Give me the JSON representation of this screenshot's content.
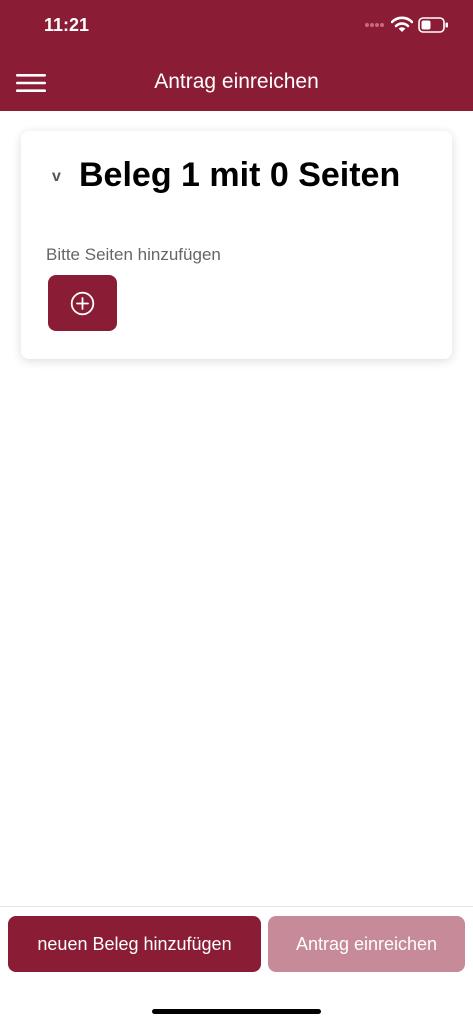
{
  "status_bar": {
    "time": "11:21"
  },
  "header": {
    "title": "Antrag einreichen",
    "menu_icon": "hamburger-menu-icon"
  },
  "card": {
    "collapse_glyph": "v",
    "title": "Beleg 1 mit 0 Seiten",
    "hint": "Bitte Seiten hinzufügen",
    "add_icon": "plus-circle-icon"
  },
  "footer": {
    "new_receipt_label": "neuen Beleg hinzufügen",
    "submit_label": "Antrag einreichen"
  },
  "colors": {
    "brand": "#8a1d35",
    "brand_disabled": "#c78a98",
    "background": "#ffffff"
  }
}
